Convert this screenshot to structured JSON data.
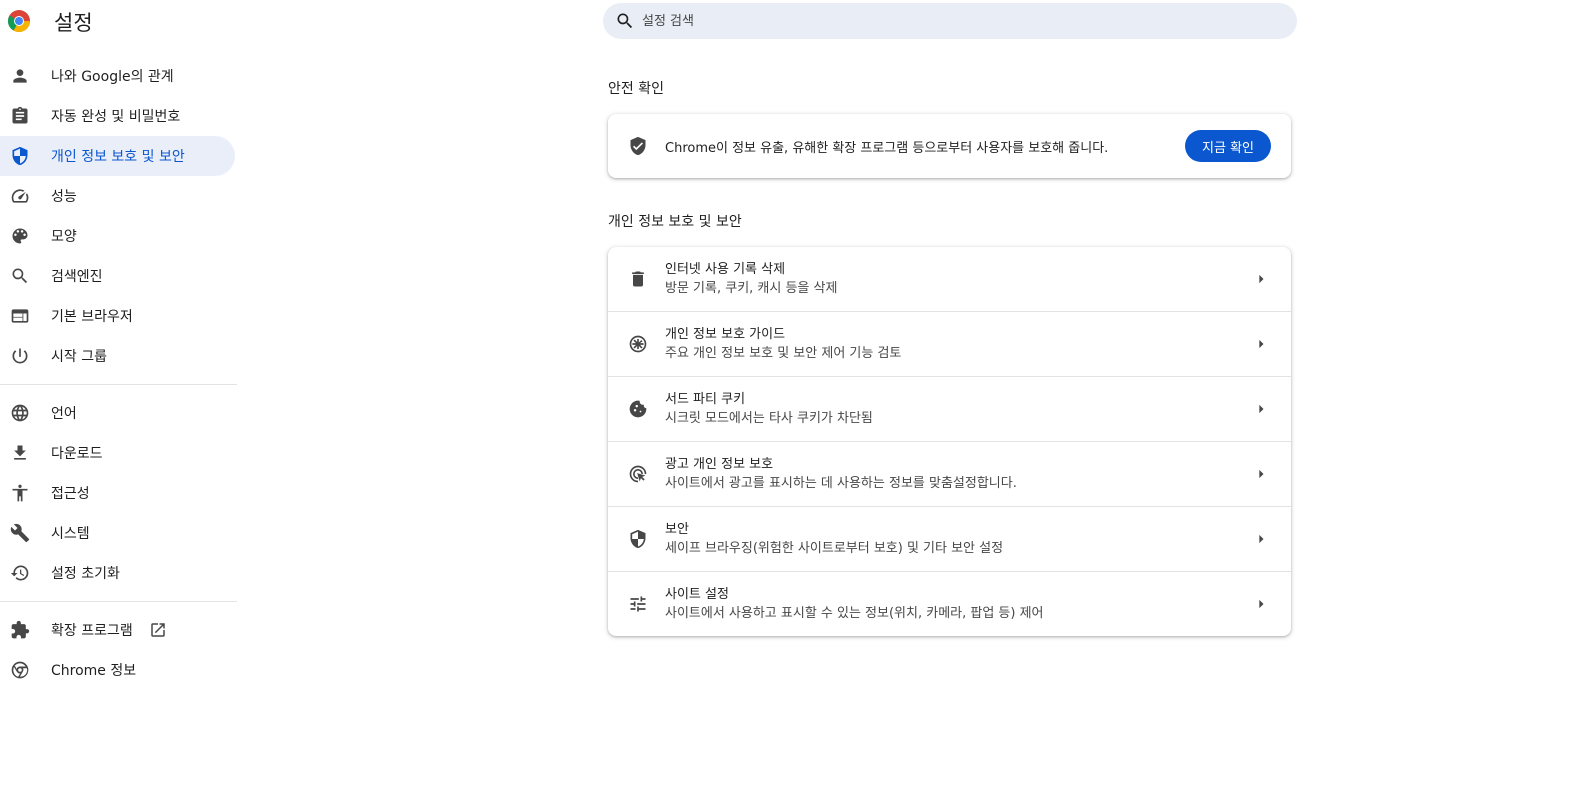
{
  "header": {
    "title": "설정"
  },
  "search": {
    "placeholder": "설정 검색"
  },
  "sidebar": {
    "items": [
      {
        "label": "나와 Google의 관계",
        "icon": "person-icon"
      },
      {
        "label": "자동 완성 및 비밀번호",
        "icon": "clipboard-icon"
      },
      {
        "label": "개인 정보 보호 및 보안",
        "icon": "shield-icon",
        "active": true
      },
      {
        "label": "성능",
        "icon": "speedometer-icon"
      },
      {
        "label": "모양",
        "icon": "palette-icon"
      },
      {
        "label": "검색엔진",
        "icon": "search-icon"
      },
      {
        "label": "기본 브라우저",
        "icon": "browser-icon"
      },
      {
        "label": "시작 그룹",
        "icon": "power-icon"
      }
    ],
    "items2": [
      {
        "label": "언어",
        "icon": "globe-icon"
      },
      {
        "label": "다운로드",
        "icon": "download-icon"
      },
      {
        "label": "접근성",
        "icon": "accessibility-icon"
      },
      {
        "label": "시스템",
        "icon": "wrench-icon"
      },
      {
        "label": "설정 초기화",
        "icon": "history-icon"
      }
    ],
    "extensions": {
      "label": "확장 프로그램",
      "icon": "puzzle-icon"
    },
    "about": {
      "label": "Chrome 정보",
      "icon": "chrome-icon"
    }
  },
  "safety_check": {
    "title": "안전 확인",
    "text": "Chrome이 정보 유출, 유해한 확장 프로그램 등으로부터 사용자를 보호해 줍니다.",
    "button": "지금 확인"
  },
  "privacy": {
    "title": "개인 정보 보호 및 보안",
    "rows": [
      {
        "title": "인터넷 사용 기록 삭제",
        "subtitle": "방문 기록, 쿠키, 캐시 등을 삭제",
        "icon": "trash-icon"
      },
      {
        "title": "개인 정보 보호 가이드",
        "subtitle": "주요 개인 정보 보호 및 보안 제어 기능 검토",
        "icon": "compass-icon"
      },
      {
        "title": "서드 파티 쿠키",
        "subtitle": "시크릿 모드에서는 타사 쿠키가 차단됨",
        "icon": "cookie-icon"
      },
      {
        "title": "광고 개인 정보 보호",
        "subtitle": "사이트에서 광고를 표시하는 데 사용하는 정보를 맞춤설정합니다.",
        "icon": "ad-privacy-icon"
      },
      {
        "title": "보안",
        "subtitle": "세이프 브라우징(위험한 사이트로부터 보호) 및 기타 보안 설정",
        "icon": "security-shield-icon"
      },
      {
        "title": "사이트 설정",
        "subtitle": "사이트에서 사용하고 표시할 수 있는 정보(위치, 카메라, 팝업 등) 제어",
        "icon": "tune-icon"
      }
    ]
  },
  "colors": {
    "accent": "#0b57d0",
    "active_bg": "#e9eef8",
    "search_bg": "#e9eef6"
  }
}
